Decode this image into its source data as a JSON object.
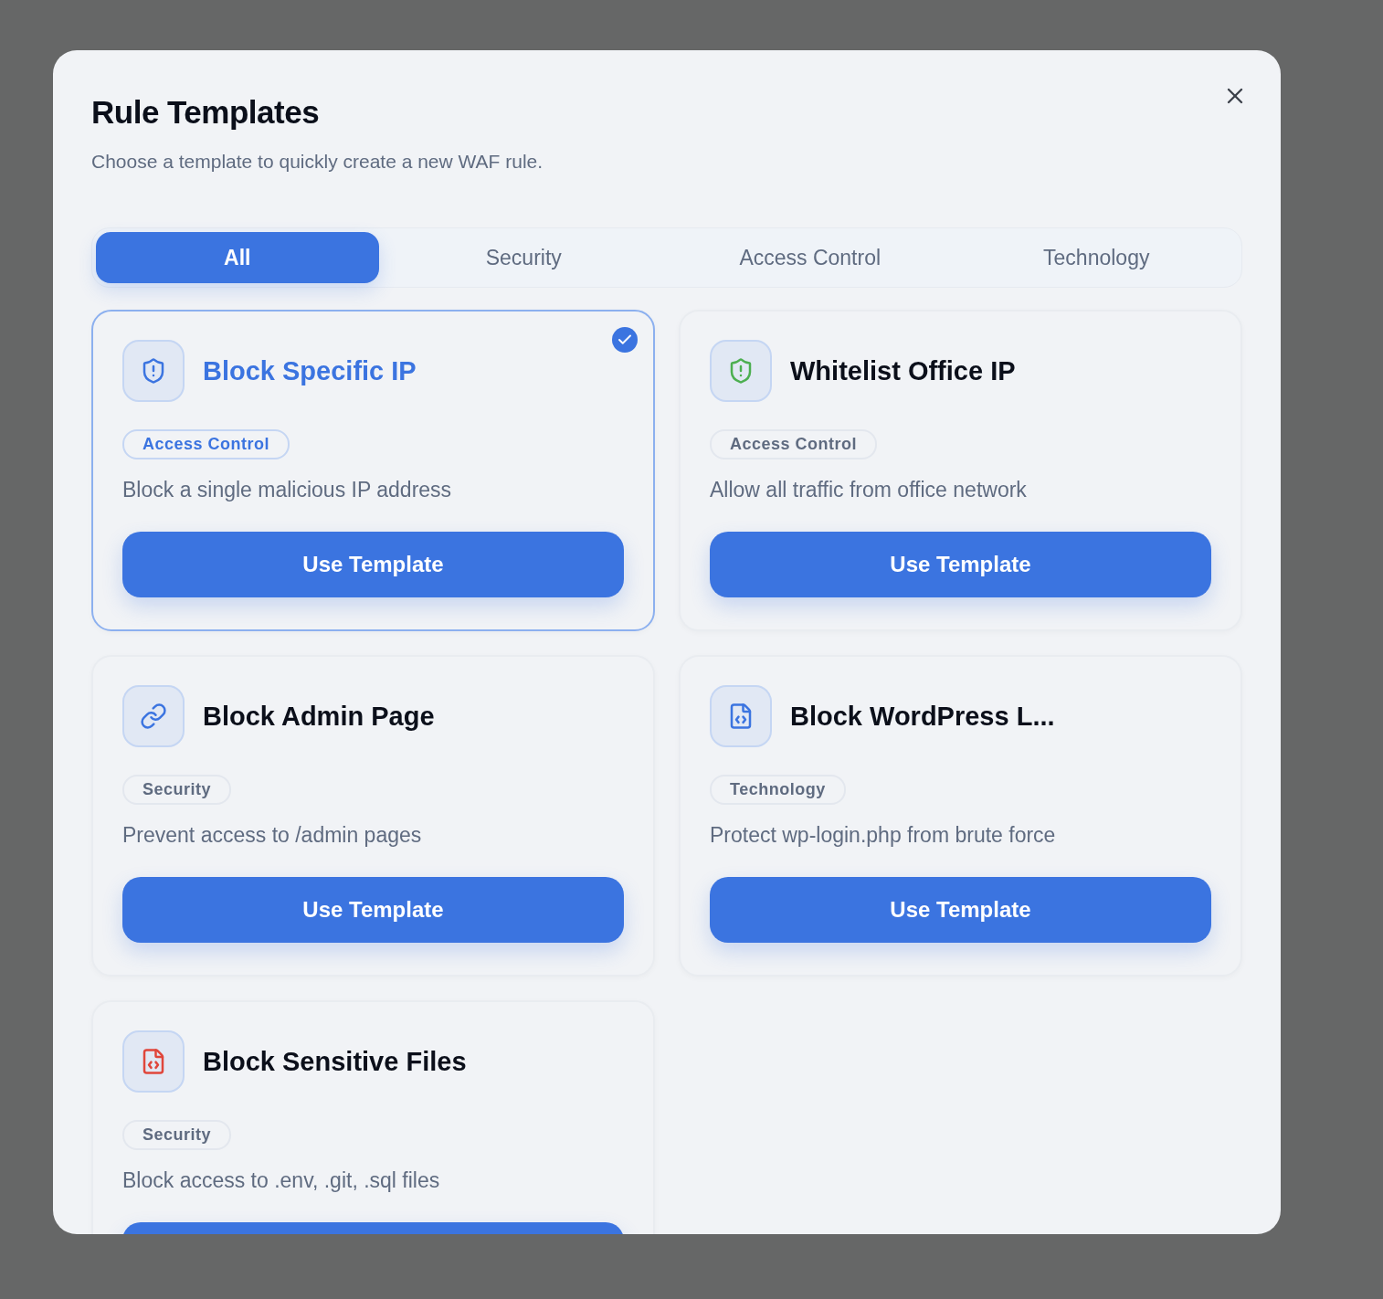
{
  "dialog": {
    "title": "Rule Templates",
    "subtitle": "Choose a template to quickly create a new WAF rule."
  },
  "tabs": [
    {
      "label": "All",
      "selected": true
    },
    {
      "label": "Security",
      "selected": false
    },
    {
      "label": "Access Control",
      "selected": false
    },
    {
      "label": "Technology",
      "selected": false
    }
  ],
  "templates": [
    {
      "kind": "shield",
      "color": "#3b74e0",
      "title": "Block Specific IP",
      "tag": "Access Control",
      "description": "Block a single malicious IP address",
      "button": "Use Template",
      "selected": true
    },
    {
      "kind": "shield",
      "color": "#4caf50",
      "title": "Whitelist Office IP",
      "tag": "Access Control",
      "description": "Allow all traffic from office network",
      "button": "Use Template",
      "selected": false
    },
    {
      "kind": "link",
      "color": "#3b74e0",
      "title": "Block Admin Page",
      "tag": "Security",
      "description": "Prevent access to /admin pages",
      "button": "Use Template",
      "selected": false
    },
    {
      "kind": "file-code",
      "color": "#3b74e0",
      "title": "Block WordPress L...",
      "tag": "Technology",
      "description": "Protect wp-login.php from brute force",
      "button": "Use Template",
      "selected": false
    },
    {
      "kind": "file-code",
      "color": "#e0463b",
      "title": "Block Sensitive Files",
      "tag": "Security",
      "description": "Block access to .env, .git, .sql files",
      "selected": false
    }
  ]
}
